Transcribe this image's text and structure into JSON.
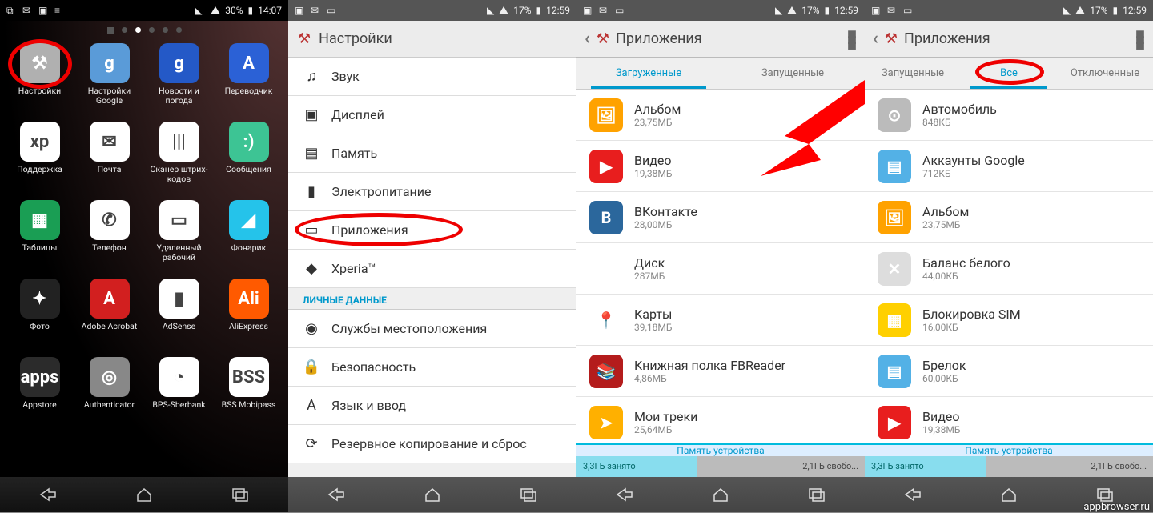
{
  "status": {
    "p1": {
      "battery_pct": "30%",
      "time": "14:07"
    },
    "others": {
      "battery_pct": "17%",
      "time": "12:59"
    }
  },
  "panel1": {
    "apps": [
      {
        "label": "Настройки",
        "icon": "⚒",
        "bg": "#b0b0b0",
        "ring": true
      },
      {
        "label": "Настройки Google",
        "icon": "g",
        "bg": "#5a9bd8"
      },
      {
        "label": "Новости и погода",
        "icon": "g",
        "bg": "#2459c7"
      },
      {
        "label": "Переводчик",
        "icon": "A",
        "bg": "#2b61d6"
      },
      {
        "label": "Поддержка",
        "icon": "xp",
        "bg": "#fff"
      },
      {
        "label": "Почта",
        "icon": "✉",
        "bg": "#fff"
      },
      {
        "label": "Сканер штрих-кодов",
        "icon": "|||",
        "bg": "#fff"
      },
      {
        "label": "Сообщения",
        "icon": ":)",
        "bg": "#3dc494"
      },
      {
        "label": "Таблицы",
        "icon": "▦",
        "bg": "#1a9e54"
      },
      {
        "label": "Телефон",
        "icon": "✆",
        "bg": "#fff"
      },
      {
        "label": "Удаленный рабочий",
        "icon": "▭",
        "bg": "#fff"
      },
      {
        "label": "Фонарик",
        "icon": "◢",
        "bg": "#25c3ea"
      },
      {
        "label": "Фото",
        "icon": "✦",
        "bg": "#222"
      },
      {
        "label": "Adobe Acrobat",
        "icon": "A",
        "bg": "#d21f1f"
      },
      {
        "label": "AdSense",
        "icon": "▮",
        "bg": "#fff"
      },
      {
        "label": "AliExpress",
        "icon": "Ali",
        "bg": "#ff5a00"
      },
      {
        "label": "Appstore",
        "icon": "apps",
        "bg": "#2b2b2b"
      },
      {
        "label": "Authenticator",
        "icon": "◎",
        "bg": "#888"
      },
      {
        "label": "BPS-Sberbank",
        "icon": "◔",
        "bg": "#fff"
      },
      {
        "label": "BSS Mobipass",
        "icon": "BSS",
        "bg": "#fff"
      }
    ]
  },
  "panel2": {
    "title": "Настройки",
    "items": [
      {
        "label": "Звук",
        "icon": "♫",
        "ring": false
      },
      {
        "label": "Дисплей",
        "icon": "▣",
        "ring": false
      },
      {
        "label": "Память",
        "icon": "▤",
        "ring": false
      },
      {
        "label": "Электропитание",
        "icon": "▮",
        "ring": false
      },
      {
        "label": "Приложения",
        "icon": "▭",
        "ring": true
      },
      {
        "label": "Xperia™",
        "icon": "◆",
        "ring": false
      }
    ],
    "section": "ЛИЧНЫЕ ДАННЫЕ",
    "items2": [
      {
        "label": "Службы местоположения",
        "icon": "◉"
      },
      {
        "label": "Безопасность",
        "icon": "🔒"
      },
      {
        "label": "Язык и ввод",
        "icon": "A"
      },
      {
        "label": "Резервное копирование и сброс",
        "icon": "⟳"
      }
    ]
  },
  "panel3": {
    "title": "Приложения",
    "tabs": [
      "Загруженные",
      "Запущенные"
    ],
    "tab_selected": 0,
    "apps": [
      {
        "name": "Альбом",
        "size": "23,75МБ",
        "bg": "#ffa200",
        "icon": "🖼"
      },
      {
        "name": "Видео",
        "size": "19,38МБ",
        "bg": "#e81e1e",
        "icon": "▶"
      },
      {
        "name": "ВКонтакте",
        "size": "28,00МБ",
        "bg": "#2b679c",
        "icon": "B"
      },
      {
        "name": "Диск",
        "size": "287МБ",
        "bg": "#fff",
        "icon": "△"
      },
      {
        "name": "Карты",
        "size": "39,18МБ",
        "bg": "#fff",
        "icon": "📍"
      },
      {
        "name": "Книжная полка FBReader",
        "size": "4,86МБ",
        "bg": "#b41c1c",
        "icon": "📚"
      },
      {
        "name": "Мои треки",
        "size": "25,64МБ",
        "bg": "#ffb000",
        "icon": "➤"
      }
    ],
    "storage": {
      "label": "Память устройства",
      "used": "3,3ГБ занято",
      "free": "2,1ГБ свобо..."
    }
  },
  "panel4": {
    "title": "Приложения",
    "tabs": [
      "Запущенные",
      "Все",
      "Отключенные"
    ],
    "tab_selected": 1,
    "apps": [
      {
        "name": "Автомобиль",
        "size": "848КБ",
        "bg": "#bbb",
        "icon": "⊙"
      },
      {
        "name": "Аккаунты Google",
        "size": "712КБ",
        "bg": "#53b1e6",
        "icon": "▤"
      },
      {
        "name": "Альбом",
        "size": "23,75МБ",
        "bg": "#ffa200",
        "icon": "🖼"
      },
      {
        "name": "Баланс белого",
        "size": "44,00КБ",
        "bg": "#ddd",
        "icon": "✕"
      },
      {
        "name": "Блокировка SIM",
        "size": "16,00КБ",
        "bg": "#ffd000",
        "icon": "▦"
      },
      {
        "name": "Брелок",
        "size": "60,00КБ",
        "bg": "#53b1e6",
        "icon": "▤"
      },
      {
        "name": "Видео",
        "size": "19,38МБ",
        "bg": "#e81e1e",
        "icon": "▶"
      }
    ],
    "storage": {
      "label": "Память устройства",
      "used": "3,3ГБ занято",
      "free": "2,1ГБ свобо..."
    }
  },
  "watermark": "appbrowser.ru"
}
